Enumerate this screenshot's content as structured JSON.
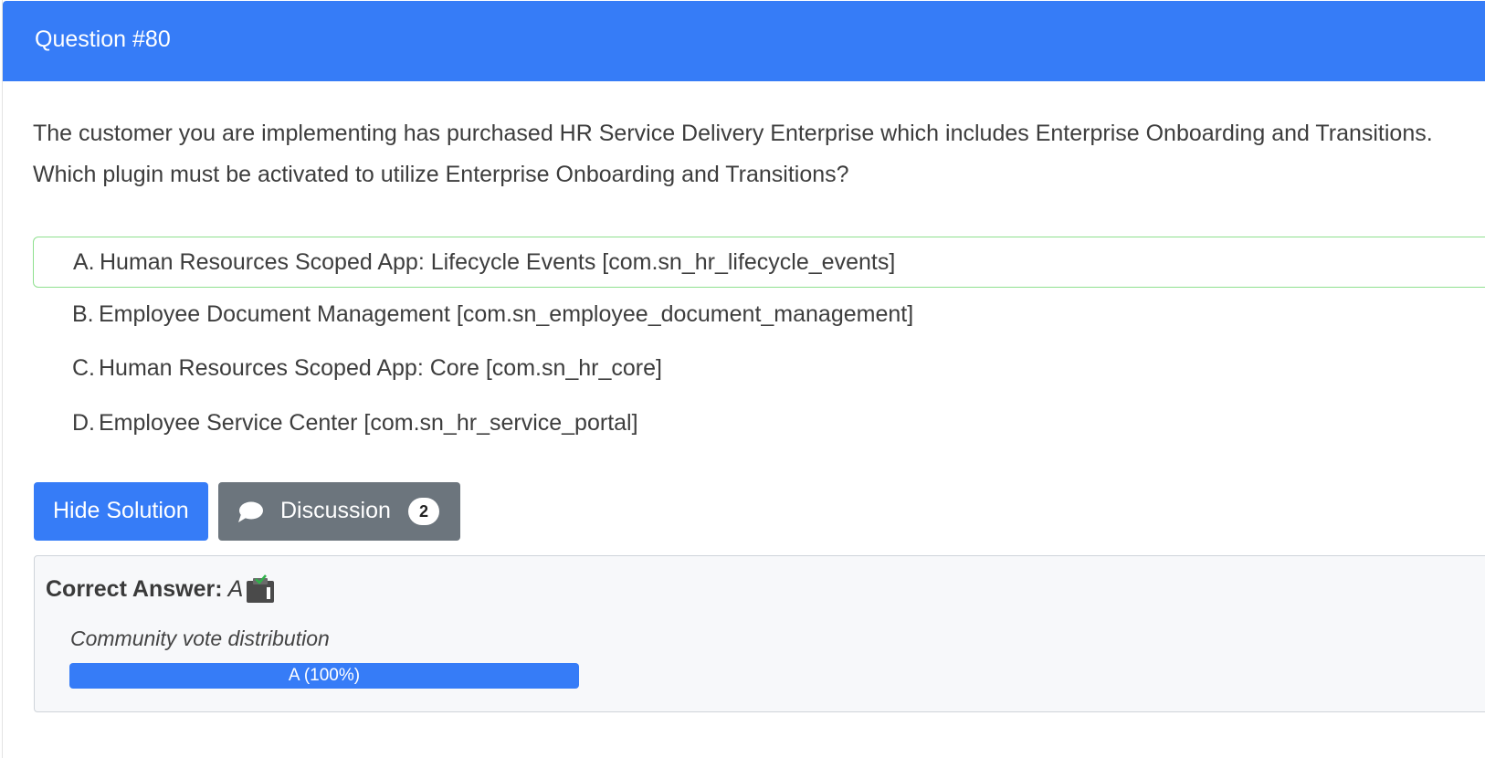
{
  "header": {
    "title": "Question #80"
  },
  "question": {
    "lines": [
      "The customer you are implementing has purchased HR Service Delivery Enterprise which includes Enterprise Onboarding and Transitions.",
      "Which plugin must be activated to utilize Enterprise Onboarding and Transitions?"
    ]
  },
  "choices": [
    {
      "letter": "A.",
      "text": "Human Resources Scoped App: Lifecycle Events [com.sn_hr_lifecycle_events]",
      "correct": true
    },
    {
      "letter": "B.",
      "text": "Employee Document Management [com.sn_employee_document_management]",
      "correct": false
    },
    {
      "letter": "C.",
      "text": "Human Resources Scoped App: Core [com.sn_hr_core]",
      "correct": false
    },
    {
      "letter": "D.",
      "text": "Employee Service Center [com.sn_hr_service_portal]",
      "correct": false
    }
  ],
  "buttons": {
    "hide_solution": "Hide Solution",
    "discussion": "Discussion",
    "discussion_count": "2"
  },
  "answer": {
    "label": "Correct Answer:",
    "value": "A",
    "vote_label": "Community vote distribution",
    "votes": [
      {
        "label": "A (100%)",
        "percent": 100
      }
    ]
  },
  "colors": {
    "primary": "#367cf7",
    "secondary": "#6c757d",
    "correct_border": "#8fe08f"
  },
  "icons": {
    "discussion": "chat-bubble-icon",
    "answer": "clipboard-check-icon"
  }
}
